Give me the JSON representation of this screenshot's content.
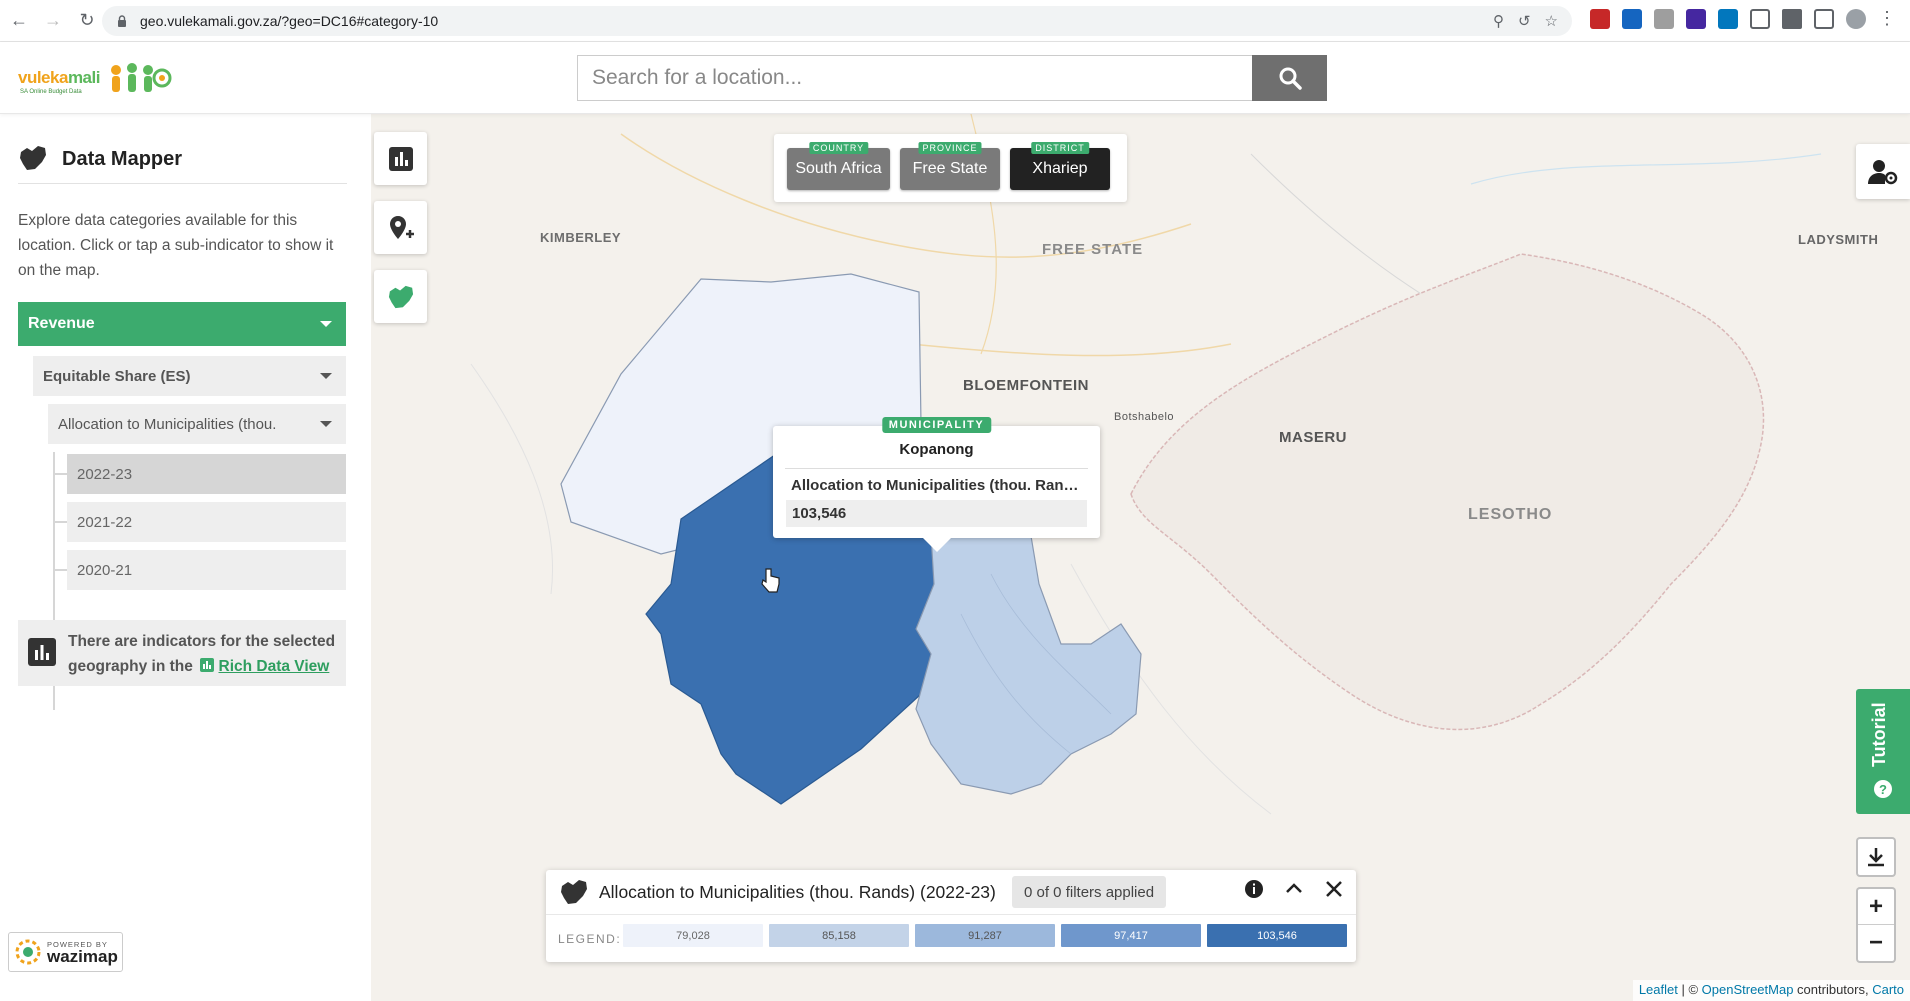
{
  "browser": {
    "url": "geo.vulekamali.gov.za/?geo=DC16#category-10"
  },
  "header": {
    "logo_text_1": "vuleka",
    "logo_text_2": "mali",
    "logo_sub": "SA Online Budget Data",
    "search_placeholder": "Search for a location..."
  },
  "sidebar": {
    "title": "Data Mapper",
    "description": "Explore data categories available for this location. Click or tap a sub-indicator to show it on the map.",
    "category": "Revenue",
    "subcategory": "Equitable Share (ES)",
    "indicator": "Allocation to Municipalities (thou.",
    "years": [
      "2022-23",
      "2021-22",
      "2020-21"
    ],
    "active_year": "2022-23",
    "rich_text": "There are indicators for the selected geography in the",
    "rich_link": "Rich Data View",
    "powered_by": "POWERED BY",
    "wazimap": "wazimap"
  },
  "map": {
    "breadcrumbs": [
      {
        "tag": "COUNTRY",
        "label": "South Africa"
      },
      {
        "tag": "PROVINCE",
        "label": "Free State"
      },
      {
        "tag": "DISTRICT",
        "label": "Xhariep"
      }
    ],
    "labels": {
      "kimberley": "KIMBERLEY",
      "free_state": "FREE STATE",
      "bloemfontein": "BLOEMFONTEIN",
      "botshabelo": "Botshabelo",
      "maseru": "MASERU",
      "lesotho": "LESOTHO",
      "ladysmith": "LADYSMITH"
    },
    "tooltip": {
      "tag": "MUNICIPALITY",
      "name": "Kopanong",
      "indicator": "Allocation to Municipalities (thou. Rands) (2022-23)",
      "value": "103,546"
    },
    "tutorial": "Tutorial",
    "zoom_in": "+",
    "zoom_out": "−",
    "attribution": {
      "leaflet": "Leaflet",
      "sep": " | © ",
      "osm": "OpenStreetMap",
      "contrib": " contributors, ",
      "carto": "Carto"
    }
  },
  "legend": {
    "title": "Allocation to Municipalities (thou. Rands) (2022-23)",
    "filters": "0 of 0 filters applied",
    "label": "LEGEND:",
    "items": [
      {
        "value": "79,028",
        "color": "#eef2fa",
        "text_color": "#666"
      },
      {
        "value": "85,158",
        "color": "#c3d3e8",
        "text_color": "#555"
      },
      {
        "value": "91,287",
        "color": "#9cb8dc",
        "text_color": "#555"
      },
      {
        "value": "97,417",
        "color": "#6f97cc",
        "text_color": "#fff"
      },
      {
        "value": "103,546",
        "color": "#3a70b0",
        "text_color": "#fff"
      }
    ]
  },
  "colors": {
    "accent_green": "#3cab6e",
    "region_dark": "#3a70b0",
    "region_mid": "#bdd0e8",
    "region_light": "#eef2fa"
  }
}
